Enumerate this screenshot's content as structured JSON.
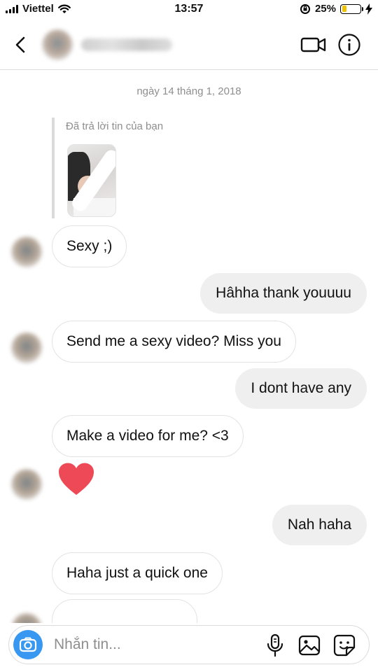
{
  "status_bar": {
    "carrier": "Viettel",
    "time": "13:57",
    "battery": "25%",
    "battery_level": 0.25,
    "battery_color": "#f2c200"
  },
  "header": {
    "back_icon": "chevron-left-icon",
    "video_icon": "video-camera-icon",
    "info_icon": "info-icon"
  },
  "chat": {
    "date": "ngày 14 tháng 1, 2018",
    "reply_label": "Đã trả lời tin của bạn",
    "messages": [
      {
        "side": "in",
        "text": "Sexy ;)"
      },
      {
        "side": "out",
        "text": "Hâhha thank youuuu"
      },
      {
        "side": "in",
        "text": "Send me a sexy video? Miss you"
      },
      {
        "side": "out",
        "text": "I dont have any"
      },
      {
        "side": "in",
        "text": "Make a video for me? <3"
      },
      {
        "side": "in",
        "text": "❤",
        "kind": "heart"
      },
      {
        "side": "out",
        "text": "Nah haha"
      },
      {
        "side": "in",
        "text": "Haha just a quick one"
      }
    ]
  },
  "composer": {
    "placeholder": "Nhắn tin...",
    "camera_icon": "camera-icon",
    "mic_icon": "microphone-icon",
    "gallery_icon": "gallery-icon",
    "sticker_icon": "sticker-icon"
  },
  "colors": {
    "accent": "#3897f0",
    "heart": "#ed4956",
    "outgoing_bubble": "#efefef"
  }
}
